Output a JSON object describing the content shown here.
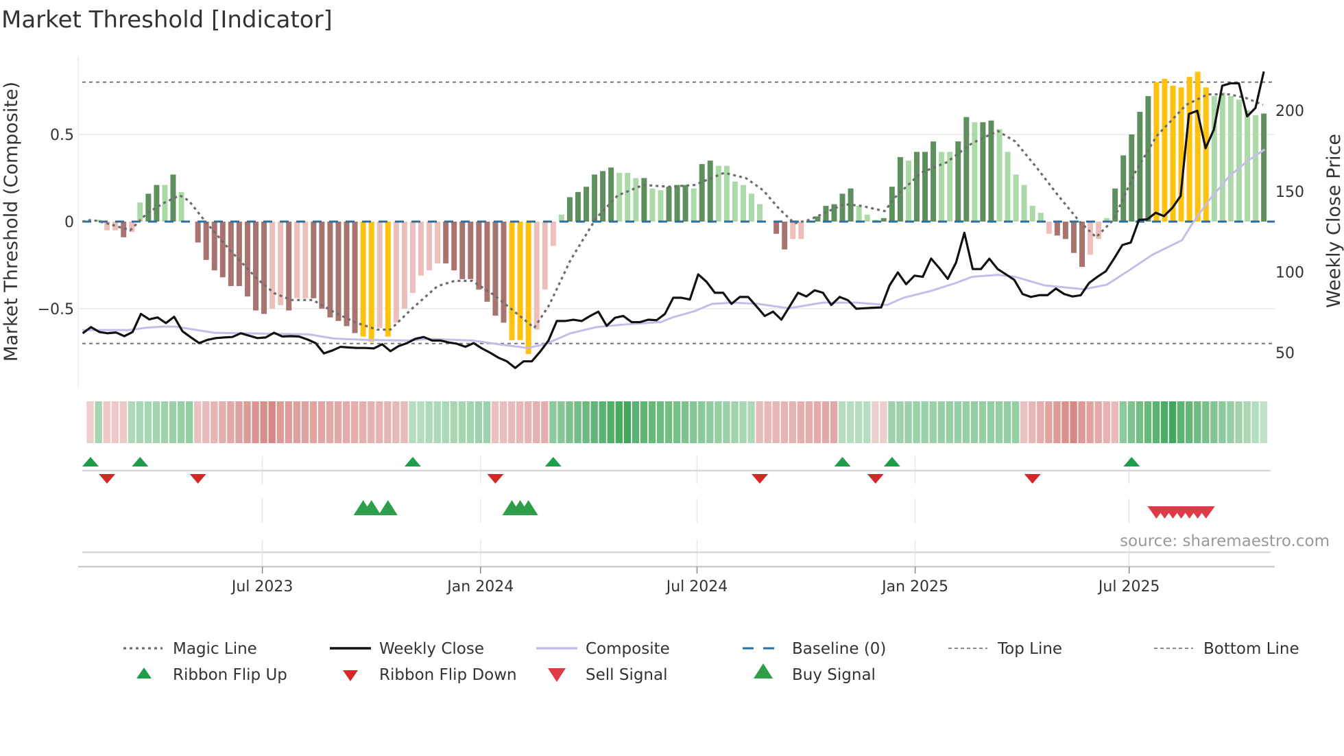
{
  "title": "Market Threshold [Indicator]",
  "source": "source: sharemaestro.com",
  "colors": {
    "dark_green": "#5f8f5f",
    "light_green": "#acd9a8",
    "dark_red": "#a9746f",
    "light_red": "#edbfbb",
    "yellow": "#ffc20e",
    "close": "#111111",
    "composite": "#c4bde9",
    "magic": "#6d6d6d",
    "baseline": "#2c6e9e",
    "ribbon_pos": "#2e9e4a",
    "ribbon_neg": "#c9605c",
    "flip_up": "#1e9e4a",
    "flip_down": "#d62728",
    "sell": "#e03a48",
    "buy": "#2e9e4a"
  },
  "chart_data": {
    "type": "bar+line",
    "title": "Market Threshold [Indicator]",
    "ylabel_left": "Market Threshold (Composite)",
    "ylabel_right": "Weekly Close Price",
    "yticks_left": [
      {
        "v": 0.5,
        "label": "0.5"
      },
      {
        "v": 0,
        "label": "0"
      },
      {
        "v": -0.5,
        "label": "−0.5"
      }
    ],
    "yticks_right": [
      {
        "v": 200,
        "label": "200"
      },
      {
        "v": 150,
        "label": "150"
      },
      {
        "v": 100,
        "label": "100"
      },
      {
        "v": 50,
        "label": "50"
      }
    ],
    "ylim_left": [
      -0.95,
      0.95
    ],
    "top_line": 0.8,
    "bottom_line": -0.7,
    "xticks": [
      {
        "week": 20.8,
        "label": "Jul 2023"
      },
      {
        "week": 47.2,
        "label": "Jan 2024"
      },
      {
        "week": 73.4,
        "label": "Jul 2024"
      },
      {
        "week": 99.8,
        "label": "Jan 2025"
      },
      {
        "week": 125.7,
        "label": "Jul 2025"
      }
    ],
    "bars": [
      [
        0,
        "N"
      ],
      [
        0.01,
        "N"
      ],
      [
        -0.05,
        "LR"
      ],
      [
        -0.05,
        "LR"
      ],
      [
        -0.09,
        "DR"
      ],
      [
        -0.06,
        "LR"
      ],
      [
        0.11,
        "LG"
      ],
      [
        0.16,
        "DG"
      ],
      [
        0.21,
        "DG"
      ],
      [
        0.21,
        "LG"
      ],
      [
        0.27,
        "DG"
      ],
      [
        0.17,
        "LG"
      ],
      [
        0,
        "N"
      ],
      [
        -0.12,
        "DR"
      ],
      [
        -0.22,
        "DR"
      ],
      [
        -0.28,
        "DR"
      ],
      [
        -0.32,
        "DR"
      ],
      [
        -0.37,
        "DR"
      ],
      [
        -0.37,
        "DR"
      ],
      [
        -0.43,
        "DR"
      ],
      [
        -0.51,
        "DR"
      ],
      [
        -0.53,
        "DR"
      ],
      [
        -0.5,
        "LR"
      ],
      [
        -0.48,
        "LR"
      ],
      [
        -0.51,
        "DR"
      ],
      [
        -0.44,
        "LR"
      ],
      [
        -0.44,
        "LR"
      ],
      [
        -0.44,
        "DR"
      ],
      [
        -0.5,
        "DR"
      ],
      [
        -0.55,
        "DR"
      ],
      [
        -0.57,
        "DR"
      ],
      [
        -0.6,
        "DR"
      ],
      [
        -0.64,
        "DR"
      ],
      [
        -0.66,
        "Y"
      ],
      [
        -0.69,
        "Y"
      ],
      [
        -0.61,
        "LR"
      ],
      [
        -0.66,
        "Y"
      ],
      [
        -0.58,
        "LR"
      ],
      [
        -0.5,
        "LR"
      ],
      [
        -0.41,
        "LR"
      ],
      [
        -0.31,
        "LR"
      ],
      [
        -0.28,
        "LR"
      ],
      [
        -0.24,
        "LR"
      ],
      [
        -0.24,
        "DR"
      ],
      [
        -0.28,
        "DR"
      ],
      [
        -0.33,
        "DR"
      ],
      [
        -0.33,
        "DR"
      ],
      [
        -0.39,
        "DR"
      ],
      [
        -0.46,
        "DR"
      ],
      [
        -0.54,
        "DR"
      ],
      [
        -0.58,
        "DR"
      ],
      [
        -0.68,
        "Y"
      ],
      [
        -0.68,
        "Y"
      ],
      [
        -0.76,
        "Y"
      ],
      [
        -0.62,
        "LR"
      ],
      [
        -0.39,
        "LR"
      ],
      [
        -0.14,
        "LR"
      ],
      [
        0.04,
        "LG"
      ],
      [
        0.14,
        "DG"
      ],
      [
        0.17,
        "DG"
      ],
      [
        0.2,
        "DG"
      ],
      [
        0.27,
        "DG"
      ],
      [
        0.29,
        "DG"
      ],
      [
        0.31,
        "DG"
      ],
      [
        0.28,
        "LG"
      ],
      [
        0.28,
        "LG"
      ],
      [
        0.25,
        "LG"
      ],
      [
        0.25,
        "DG"
      ],
      [
        0.19,
        "LG"
      ],
      [
        0.18,
        "LG"
      ],
      [
        0.2,
        "DG"
      ],
      [
        0.21,
        "DG"
      ],
      [
        0.21,
        "DG"
      ],
      [
        0.19,
        "LG"
      ],
      [
        0.33,
        "DG"
      ],
      [
        0.35,
        "DG"
      ],
      [
        0.32,
        "LG"
      ],
      [
        0.32,
        "LG"
      ],
      [
        0.23,
        "LG"
      ],
      [
        0.21,
        "LG"
      ],
      [
        0.16,
        "LG"
      ],
      [
        0.1,
        "LG"
      ],
      [
        0,
        "N"
      ],
      [
        -0.07,
        "DR"
      ],
      [
        -0.16,
        "DR"
      ],
      [
        -0.1,
        "LR"
      ],
      [
        -0.1,
        "LR"
      ],
      [
        0,
        "N"
      ],
      [
        0.03,
        "DG"
      ],
      [
        0.09,
        "DG"
      ],
      [
        0.1,
        "DG"
      ],
      [
        0.16,
        "DG"
      ],
      [
        0.19,
        "DG"
      ],
      [
        0.09,
        "LG"
      ],
      [
        0.04,
        "LG"
      ],
      [
        0.01,
        "LG"
      ],
      [
        0.02,
        "DG"
      ],
      [
        0.2,
        "DG"
      ],
      [
        0.37,
        "DG"
      ],
      [
        0.35,
        "LG"
      ],
      [
        0.4,
        "DG"
      ],
      [
        0.4,
        "DG"
      ],
      [
        0.46,
        "DG"
      ],
      [
        0.4,
        "LG"
      ],
      [
        0.4,
        "LG"
      ],
      [
        0.46,
        "DG"
      ],
      [
        0.6,
        "DG"
      ],
      [
        0.57,
        "LG"
      ],
      [
        0.57,
        "DG"
      ],
      [
        0.58,
        "DG"
      ],
      [
        0.53,
        "LG"
      ],
      [
        0.4,
        "LG"
      ],
      [
        0.27,
        "LG"
      ],
      [
        0.21,
        "LG"
      ],
      [
        0.09,
        "LG"
      ],
      [
        0.05,
        "LG"
      ],
      [
        -0.07,
        "LR"
      ],
      [
        -0.08,
        "DR"
      ],
      [
        -0.1,
        "DR"
      ],
      [
        -0.18,
        "DR"
      ],
      [
        -0.26,
        "DR"
      ],
      [
        -0.19,
        "LR"
      ],
      [
        -0.1,
        "LR"
      ],
      [
        0.02,
        "LG"
      ],
      [
        0.19,
        "DG"
      ],
      [
        0.38,
        "DG"
      ],
      [
        0.5,
        "DG"
      ],
      [
        0.63,
        "DG"
      ],
      [
        0.72,
        "DG"
      ],
      [
        0.8,
        "Y"
      ],
      [
        0.82,
        "Y"
      ],
      [
        0.78,
        "Y"
      ],
      [
        0.77,
        "Y"
      ],
      [
        0.83,
        "Y"
      ],
      [
        0.86,
        "Y"
      ],
      [
        0.77,
        "Y"
      ],
      [
        0.72,
        "LG"
      ],
      [
        0.74,
        "LG"
      ],
      [
        0.72,
        "LG"
      ],
      [
        0.7,
        "LG"
      ],
      [
        0.64,
        "LG"
      ],
      [
        0.61,
        "LG"
      ],
      [
        0.62,
        "DG"
      ]
    ],
    "weekly_close": [
      62.0,
      65.8,
      62.8,
      62.0,
      62.5,
      60.2,
      62.8,
      74.0,
      70.6,
      71.8,
      68.3,
      72.2,
      63.2,
      59.5,
      55.9,
      57.9,
      59.0,
      59.4,
      59.7,
      62.0,
      60.5,
      59.0,
      59.4,
      62.3,
      60.0,
      60.2,
      60.0,
      58.2,
      55.9,
      49.5,
      51.3,
      53.6,
      53.2,
      52.9,
      52.9,
      52.6,
      55.2,
      50.9,
      54.1,
      55.9,
      58.6,
      59.7,
      57.5,
      57.5,
      56.3,
      55.5,
      53.6,
      55.9,
      52.6,
      49.9,
      46.8,
      44.6,
      40.5,
      44.6,
      44.6,
      50.6,
      57.5,
      69.6,
      69.6,
      70.4,
      69.6,
      72.7,
      75.4,
      66.6,
      71.6,
      72.7,
      68.9,
      68.9,
      70.4,
      70.1,
      74.0,
      84.0,
      84.0,
      82.9,
      98.5,
      93.9,
      87.1,
      87.1,
      80.2,
      84.5,
      84.5,
      78.7,
      72.7,
      75.4,
      70.4,
      78.7,
      87.1,
      84.8,
      88.6,
      87.1,
      79.5,
      84.5,
      82.5,
      77.2,
      77.5,
      77.8,
      78.0,
      91.6,
      99.7,
      92.4,
      97.7,
      97.0,
      108.3,
      102.3,
      95.7,
      105.8,
      124.3,
      101.8,
      101.8,
      108.2,
      101.8,
      98.5,
      95.1,
      86.3,
      84.5,
      85.6,
      85.6,
      89.7,
      86.3,
      84.8,
      85.6,
      93.2,
      97.0,
      100.4,
      108.3,
      116.7,
      118.2,
      132.3,
      132.6,
      136.7,
      134.6,
      139.7,
      147.1,
      197.9,
      199.9,
      176.7,
      188.3,
      215.4,
      216.9,
      216.9,
      196.4,
      201.7,
      224.2
    ],
    "magic_line": [
      [
        -1,
        0
      ],
      [
        0.2,
        0.01
      ],
      [
        2,
        -0.01
      ],
      [
        4.8,
        -0.05
      ],
      [
        6.9,
        0.05
      ],
      [
        9,
        0.11
      ],
      [
        10.8,
        0.15
      ],
      [
        11.9,
        0.12
      ],
      [
        13.9,
        0
      ],
      [
        17,
        -0.17
      ],
      [
        20.2,
        -0.33
      ],
      [
        22.2,
        -0.41
      ],
      [
        24.3,
        -0.45
      ],
      [
        26.9,
        -0.45
      ],
      [
        29.5,
        -0.52
      ],
      [
        32.1,
        -0.58
      ],
      [
        34.7,
        -0.62
      ],
      [
        36.3,
        -0.62
      ],
      [
        38.9,
        -0.5
      ],
      [
        42,
        -0.37
      ],
      [
        44.1,
        -0.34
      ],
      [
        46.2,
        -0.34
      ],
      [
        48.8,
        -0.42
      ],
      [
        51.4,
        -0.52
      ],
      [
        53.7,
        -0.61
      ],
      [
        55.5,
        -0.48
      ],
      [
        58.1,
        -0.22
      ],
      [
        61.2,
        0.02
      ],
      [
        63.8,
        0.15
      ],
      [
        66.9,
        0.21
      ],
      [
        70,
        0.2
      ],
      [
        73.1,
        0.21
      ],
      [
        76.7,
        0.28
      ],
      [
        79.3,
        0.25
      ],
      [
        81.4,
        0.18
      ],
      [
        83.4,
        0.07
      ],
      [
        85.2,
        -0.01
      ],
      [
        87,
        0.01
      ],
      [
        91.2,
        0.1
      ],
      [
        93.3,
        0.09
      ],
      [
        96.1,
        0.06
      ],
      [
        97.4,
        0.14
      ],
      [
        100.5,
        0.28
      ],
      [
        103.6,
        0.34
      ],
      [
        106.7,
        0.45
      ],
      [
        109.8,
        0.52
      ],
      [
        111.9,
        0.46
      ],
      [
        114.5,
        0.31
      ],
      [
        117.1,
        0.15
      ],
      [
        119.7,
        0
      ],
      [
        121.7,
        -0.09
      ],
      [
        123.8,
        0.01
      ],
      [
        126.4,
        0.28
      ],
      [
        129,
        0.49
      ],
      [
        132.6,
        0.67
      ],
      [
        135.2,
        0.73
      ],
      [
        137.8,
        0.73
      ],
      [
        139.8,
        0.71
      ],
      [
        141.9,
        0.67
      ]
    ],
    "composite": [
      [
        -1,
        64
      ],
      [
        4.6,
        64
      ],
      [
        6.7,
        65.4
      ],
      [
        8.7,
        66.1
      ],
      [
        10.3,
        66.1
      ],
      [
        15,
        62.3
      ],
      [
        18.1,
        62
      ],
      [
        26.4,
        61.3
      ],
      [
        29.5,
        58.7
      ],
      [
        33.2,
        57.9
      ],
      [
        38.4,
        57.5
      ],
      [
        41,
        58.5
      ],
      [
        46.2,
        57.5
      ],
      [
        49.3,
        55.2
      ],
      [
        52.9,
        52.9
      ],
      [
        55,
        55.2
      ],
      [
        58.1,
        62
      ],
      [
        61.2,
        65.8
      ],
      [
        64.3,
        67.3
      ],
      [
        69,
        68.9
      ],
      [
        70.5,
        71.9
      ],
      [
        73.1,
        75.7
      ],
      [
        75.2,
        80.2
      ],
      [
        77.8,
        81
      ],
      [
        80.8,
        80.2
      ],
      [
        84.5,
        77.5
      ],
      [
        88.6,
        81
      ],
      [
        92.7,
        81
      ],
      [
        96.4,
        79.5
      ],
      [
        98.4,
        84
      ],
      [
        101.6,
        88.1
      ],
      [
        104.7,
        93.1
      ],
      [
        106.7,
        97
      ],
      [
        109.8,
        98.2
      ],
      [
        111.9,
        97
      ],
      [
        115.5,
        91.6
      ],
      [
        120.2,
        89.3
      ],
      [
        123,
        92.1
      ],
      [
        125.4,
        100
      ],
      [
        128.5,
        110.6
      ],
      [
        132.1,
        119.7
      ],
      [
        133.2,
        128.8
      ],
      [
        135.3,
        144
      ],
      [
        137.8,
        159.2
      ],
      [
        139.9,
        168.3
      ],
      [
        142.1,
        175.9
      ]
    ],
    "ribbon_segments": [
      {
        "from": 0,
        "to": 0,
        "s0": -0.2,
        "s1": -0.2
      },
      {
        "from": 1,
        "to": 1,
        "s0": 0.35,
        "s1": 0.35
      },
      {
        "from": 2,
        "to": 4,
        "s0": -0.25,
        "s1": -0.25
      },
      {
        "from": 5,
        "to": 12,
        "s0": 0.3,
        "s1": 0.45
      },
      {
        "from": 13,
        "to": 22,
        "s0": -0.3,
        "s1": -0.75
      },
      {
        "from": 23,
        "to": 38,
        "s0": -0.6,
        "s1": -0.35
      },
      {
        "from": 39,
        "to": 48,
        "s0": 0.25,
        "s1": 0.4
      },
      {
        "from": 49,
        "to": 55,
        "s0": -0.3,
        "s1": -0.45
      },
      {
        "from": 56,
        "to": 65,
        "s0": 0.5,
        "s1": 0.95
      },
      {
        "from": 66,
        "to": 80,
        "s0": 0.8,
        "s1": 0.3
      },
      {
        "from": 81,
        "to": 90,
        "s0": -0.35,
        "s1": -0.5
      },
      {
        "from": 91,
        "to": 94,
        "s0": 0.25,
        "s1": 0.25
      },
      {
        "from": 95,
        "to": 96,
        "s0": -0.2,
        "s1": -0.2
      },
      {
        "from": 97,
        "to": 112,
        "s0": 0.4,
        "s1": 0.45
      },
      {
        "from": 113,
        "to": 119,
        "s0": -0.3,
        "s1": -0.75
      },
      {
        "from": 120,
        "to": 124,
        "s0": -0.6,
        "s1": -0.35
      },
      {
        "from": 125,
        "to": 131,
        "s0": 0.5,
        "s1": 0.95
      },
      {
        "from": 132,
        "to": 142,
        "s0": 0.8,
        "s1": 0.2
      }
    ],
    "ribbon_flip_up": [
      0,
      6,
      39,
      56,
      91,
      97,
      126
    ],
    "ribbon_flip_down": [
      2,
      13,
      49,
      81,
      95,
      114
    ],
    "buy_signals": [
      33,
      34,
      36,
      51,
      52,
      53
    ],
    "sell_signals": [
      129,
      130,
      131,
      132,
      133,
      134,
      135
    ],
    "legend_position": "bottom",
    "legend": [
      {
        "key": "magic",
        "label": "Magic Line"
      },
      {
        "key": "close",
        "label": "Weekly Close"
      },
      {
        "key": "composite",
        "label": "Composite"
      },
      {
        "key": "baseline",
        "label": "Baseline (0)"
      },
      {
        "key": "top",
        "label": "Top Line"
      },
      {
        "key": "bottom",
        "label": "Bottom Line"
      },
      {
        "key": "flip_up",
        "label": "Ribbon Flip Up"
      },
      {
        "key": "flip_down",
        "label": "Ribbon Flip Down"
      },
      {
        "key": "sell",
        "label": "Sell Signal"
      },
      {
        "key": "buy",
        "label": "Buy Signal"
      }
    ]
  }
}
